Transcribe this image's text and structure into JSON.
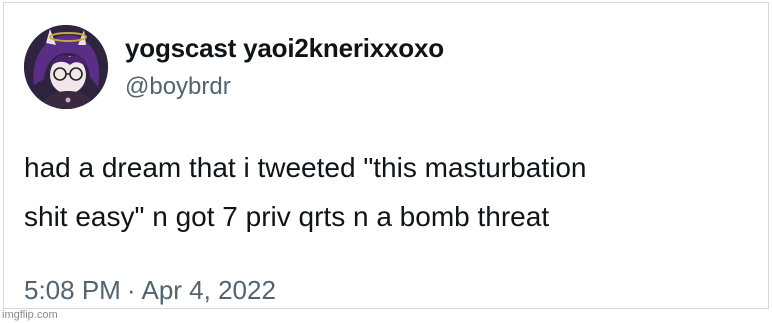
{
  "tweet": {
    "display_name": "yogscast yaoi2knerixxoxo",
    "handle": "@boybrdr",
    "text_line1": "had a dream that i tweeted \"this masturbation",
    "text_line2": "shit easy\" n got 7 priv qrts n a bomb threat",
    "time": "5:08 PM",
    "separator": "·",
    "date": "Apr 4, 2022"
  },
  "watermark": "imgflip.com",
  "colors": {
    "text": "#0f1419",
    "secondary": "#536471"
  },
  "icons": {
    "avatar": "anime-avatar-purple-hair"
  }
}
